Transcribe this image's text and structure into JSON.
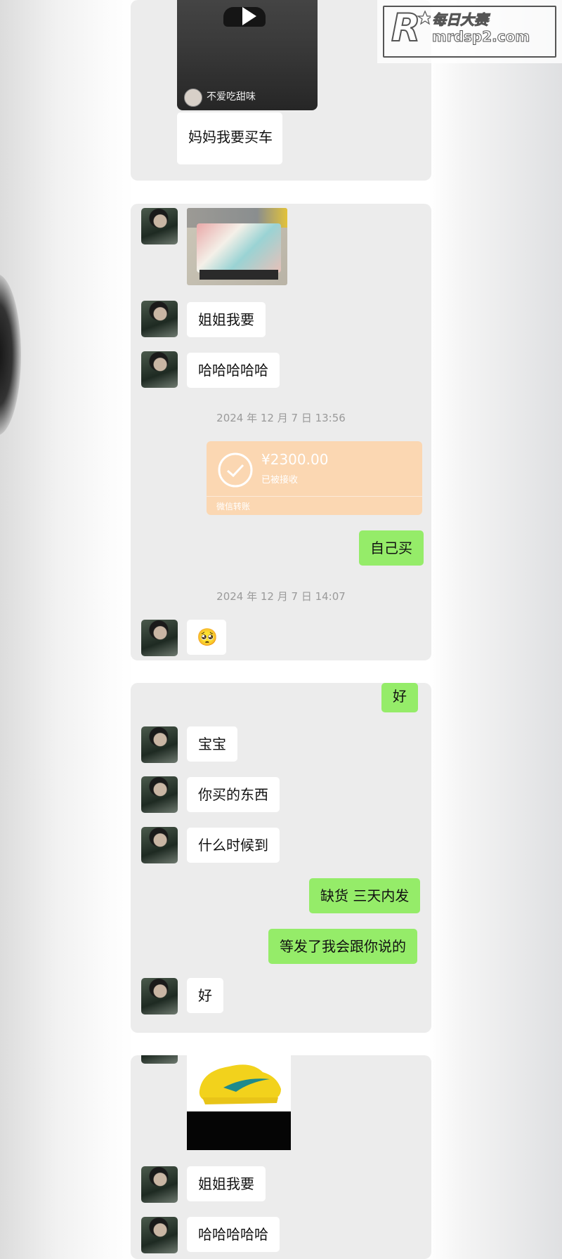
{
  "card1": {
    "video_author": "不爱吃甜味",
    "message": "妈妈我要买车"
  },
  "card2": {
    "msg1": "姐姐我要",
    "msg2": "哈哈哈哈哈",
    "timestamp1": "2024 年 12 月 7 日 13:56",
    "transfer_amount": "¥2300.00",
    "transfer_status": "已被接收",
    "transfer_footer": "微信转账",
    "reply": "自己买",
    "timestamp2": "2024 年 12 月 7 日 14:07",
    "emoji": "🥺"
  },
  "card3": {
    "reply_ok": "好",
    "msg1": "宝宝",
    "msg2": "你买的东西",
    "msg3": "什么时候到",
    "reply1": "缺货 三天内发",
    "reply2": "等发了我会跟你说的",
    "msg4": "好"
  },
  "card4": {
    "msg1": "姐姐我要",
    "msg2": "哈哈哈哈哈"
  },
  "watermark": {
    "title": "每日大赛",
    "url": "mrdsp2.com",
    "logo_letter": "R"
  },
  "colors": {
    "chat_bg": "#ececec",
    "sent_bubble": "#95ec69",
    "transfer": "#fbd7b2"
  }
}
